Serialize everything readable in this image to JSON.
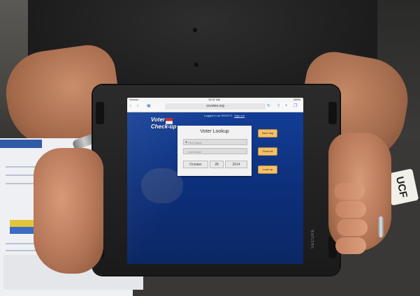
{
  "browser": {
    "carrier": "Verizon",
    "time": "10:37 AM",
    "battery": "100%",
    "url": "scvotes.org",
    "back_icon": "chevron-left-icon",
    "bookmarks_icon": "book-icon",
    "reload_icon": "reload-icon",
    "share_icon": "share-icon",
    "tabs_icon": "tabs-icon"
  },
  "app": {
    "logo_line1": "Voter",
    "logo_line2": "Check-up",
    "logged_in_text": "Logged in as GROOT1",
    "sign_out_label": "Sign out",
    "lookup_title": "Voter Lookup",
    "first_field_placeholder": "First Name",
    "second_field_placeholder": "Last Name",
    "date_month": "October",
    "date_day": "28",
    "date_year": "2014",
    "next_tag_label": "Next Tag",
    "clear_all_label": "Clear All",
    "look_up_label": "Look up",
    "colors": {
      "background": "#0d2f7a",
      "button": "#f3c06b",
      "card": "#f2f2f2"
    }
  },
  "scene": {
    "case_brand": "SECURE",
    "tag_text": "UCF"
  }
}
